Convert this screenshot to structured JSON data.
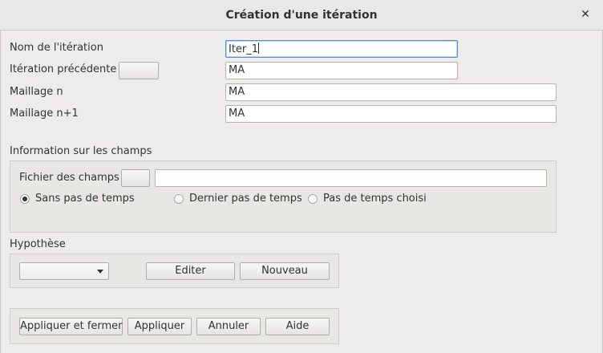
{
  "window": {
    "title": "Création d'une itération",
    "close_icon": "close-icon"
  },
  "form": {
    "iteration_name_label": "Nom de l'itération",
    "iteration_name_value": "Iter_1",
    "previous_iteration_label": "Itération précédente",
    "previous_iteration_button": "",
    "previous_iteration_value": "MA",
    "mesh_n_label": "Maillage n",
    "mesh_n_value": "MA",
    "mesh_n1_label": "Maillage n+1",
    "mesh_n1_value": "MA"
  },
  "fields": {
    "section_label": "Information sur les champs",
    "file_label": "Fichier des champs",
    "file_button": "",
    "file_value": "",
    "radio_no_timestep": "Sans pas de temps",
    "radio_last_timestep": "Dernier pas de temps",
    "radio_chosen_timestep": "Pas de temps choisi",
    "selected_radio": "Sans pas de temps"
  },
  "hypothesis": {
    "section_label": "Hypothèse",
    "combo_value": "",
    "edit_button": "Editer",
    "new_button": "Nouveau"
  },
  "actions": {
    "apply_close": "Appliquer et fermer",
    "apply": "Appliquer",
    "cancel": "Annuler",
    "help": "Aide"
  }
}
